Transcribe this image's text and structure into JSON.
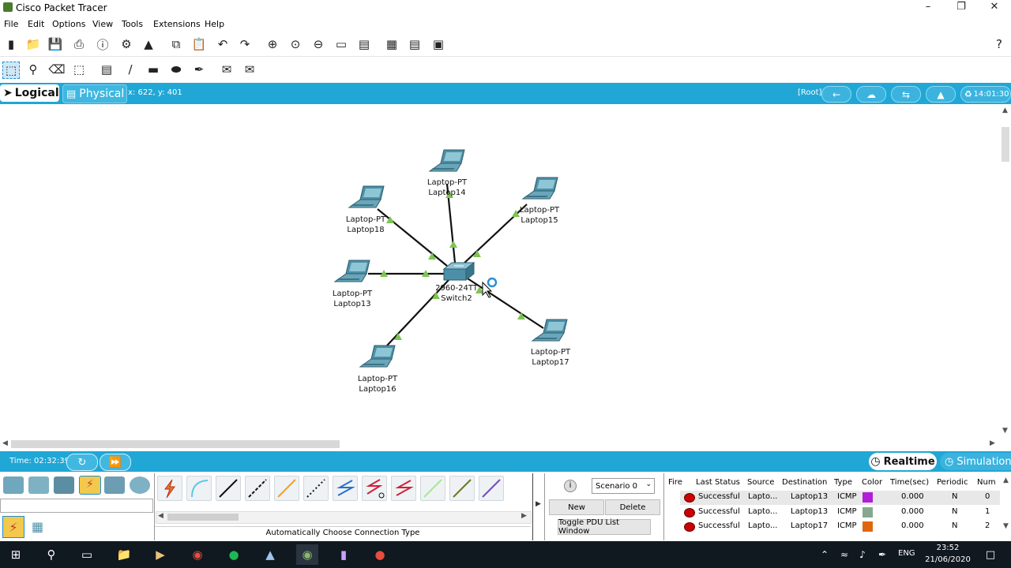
{
  "window": {
    "title": "Cisco Packet Tracer"
  },
  "menu": [
    "File",
    "Edit",
    "Options",
    "View",
    "Tools",
    "Extensions",
    "Help"
  ],
  "nav": {
    "logical_label": "Logical",
    "physical_label": "Physical",
    "coords": "x: 622, y: 401",
    "root_label": "[Root]",
    "clock": "14:01:30"
  },
  "devices": [
    {
      "model": "Laptop-PT",
      "name": "Laptop14"
    },
    {
      "model": "Laptop-PT",
      "name": "Laptop15"
    },
    {
      "model": "Laptop-PT",
      "name": "Laptop18"
    },
    {
      "model": "Laptop-PT",
      "name": "Laptop13"
    },
    {
      "model": "Laptop-PT",
      "name": "Laptop16"
    },
    {
      "model": "Laptop-PT",
      "name": "Laptop17"
    },
    {
      "model": "2960-24TT",
      "name": "Switch2"
    }
  ],
  "sim": {
    "time": "Time: 02:32:39",
    "realtime_label": "Realtime",
    "simulation_label": "Simulation"
  },
  "connections": {
    "label": "Automatically Choose Connection Type"
  },
  "scenario": {
    "selected": "Scenario 0",
    "new_label": "New",
    "delete_label": "Delete",
    "toggle_label": "Toggle PDU List Window"
  },
  "pdu": {
    "headers": [
      "Fire",
      "Last Status",
      "Source",
      "Destination",
      "Type",
      "Color",
      "Time(sec)",
      "Periodic",
      "Num"
    ],
    "rows": [
      {
        "status": "Successful",
        "source": "Lapto...",
        "destination": "Laptop13",
        "type": "ICMP",
        "color": "#b01ed8",
        "time": "0.000",
        "periodic": "N",
        "num": "0"
      },
      {
        "status": "Successful",
        "source": "Lapto...",
        "destination": "Laptop13",
        "type": "ICMP",
        "color": "#86a890",
        "time": "0.000",
        "periodic": "N",
        "num": "1"
      },
      {
        "status": "Successful",
        "source": "Lapto...",
        "destination": "Laptop17",
        "type": "ICMP",
        "color": "#e0660e",
        "time": "0.000",
        "periodic": "N",
        "num": "2"
      }
    ]
  },
  "taskbar": {
    "lang": "ENG",
    "time": "23:52",
    "date": "21/06/2020"
  },
  "colors": {
    "accent": "#20a7d6",
    "link_up": "#7dc552",
    "device": "#3f7f96"
  }
}
